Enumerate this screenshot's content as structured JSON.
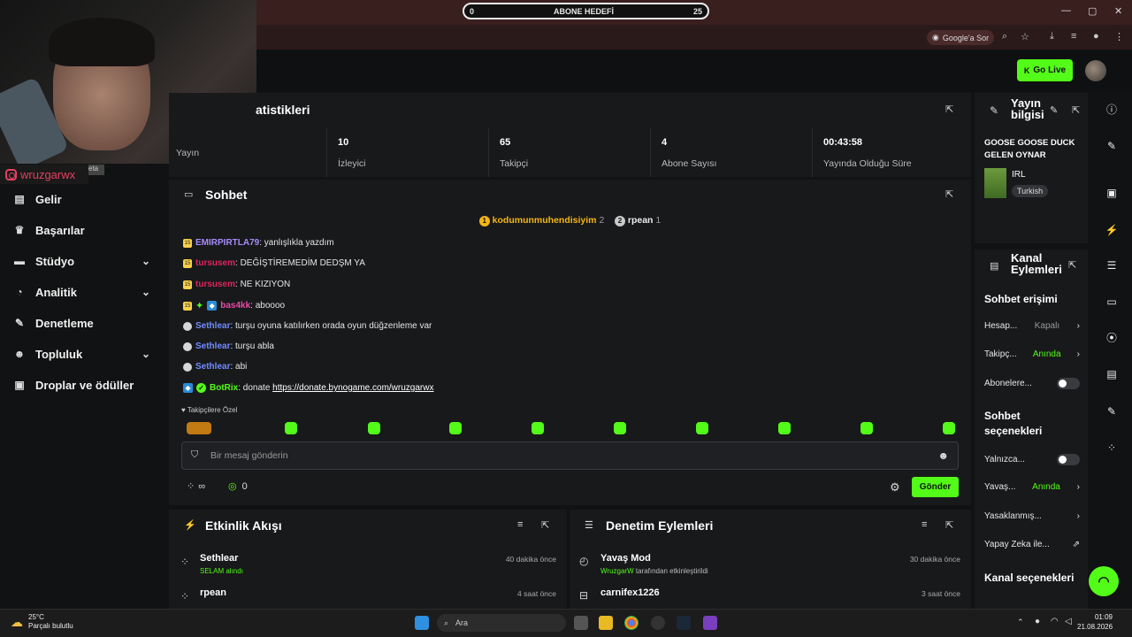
{
  "browser": {
    "goal_left": "0",
    "goal_label": "ABONE HEDEFİ",
    "goal_right": "25",
    "google_label": "Google'a Sor"
  },
  "header": {
    "go_live_label": "Go Live"
  },
  "overlay": {
    "instagram_handle": "wruzgarwx",
    "beta": "eta"
  },
  "sidebar": {
    "items": [
      {
        "label": "Gelir",
        "icon": "list-icon"
      },
      {
        "label": "Başarılar",
        "icon": "trophy-icon"
      },
      {
        "label": "Stüdyo",
        "icon": "studio-icon",
        "expandable": true
      },
      {
        "label": "Analitik",
        "icon": "chart-icon",
        "expandable": true
      },
      {
        "label": "Denetleme",
        "icon": "wrench-icon"
      },
      {
        "label": "Topluluk",
        "icon": "people-icon",
        "expandable": true
      },
      {
        "label": "Droplar ve ödüller",
        "icon": "gift-icon"
      }
    ]
  },
  "stats": {
    "title": "atistikleri",
    "cells": [
      {
        "value": "",
        "label": "Yayın"
      },
      {
        "value": "10",
        "label": "İzleyici"
      },
      {
        "value": "65",
        "label": "Takipçi"
      },
      {
        "value": "4",
        "label": "Abone Sayısı"
      },
      {
        "value": "00:43:58",
        "label": "Yayında Olduğu Süre"
      }
    ]
  },
  "chat": {
    "title": "Sohbet",
    "pinned": [
      {
        "name": "kodumunmuhendisiyim",
        "count": "2",
        "rank": "1"
      },
      {
        "name": "rpean",
        "count": "1",
        "rank": "2"
      }
    ],
    "messages": [
      {
        "user": "EMIRPIRTLA79",
        "text": ": yanlışlıkla yazdım",
        "color": "#a78bfa",
        "badges": "sub"
      },
      {
        "user": "tursusem",
        "text": ": DEĞİŞTİREMEDİM DEDŞM YA",
        "color": "#e0245e",
        "badges": "sub"
      },
      {
        "user": "tursusem",
        "text": ": NE KIZIYON",
        "color": "#e0245e",
        "badges": "sub"
      },
      {
        "user": "bas4kk",
        "text": ": aboooo",
        "color": "#e84ba6",
        "badges": "sub-star-bot"
      },
      {
        "user": "Sethlear",
        "text": ": turşu oyuna katılırken orada oyun düğzenleme var",
        "color": "#6f8cff",
        "badges": "dot"
      },
      {
        "user": "Sethlear",
        "text": ": turşu abla",
        "color": "#6f8cff",
        "badges": "dot"
      },
      {
        "user": "Sethlear",
        "text": ": abi",
        "color": "#6f8cff",
        "badges": "dot"
      },
      {
        "user": "BotRix",
        "text": ": donate ",
        "link": "https://donate.bynogame.com/wruzgarwx",
        "color": "#53fc18",
        "badges": "bot-check"
      }
    ],
    "emote_label": "Takipçilere Özel",
    "input_placeholder": "Bir mesaj gönderin",
    "count_left": "∞",
    "count_right": "0",
    "send_label": "Gönder"
  },
  "activity": {
    "title": "Etkinlik Akışı",
    "items": [
      {
        "name": "Sethlear",
        "sub": "SELAM alındı",
        "time": "40 dakika önce"
      },
      {
        "name": "rpean",
        "sub": "",
        "time": "4 saat önce"
      }
    ]
  },
  "moderation": {
    "title": "Denetim Eylemleri",
    "items": [
      {
        "name": "Yavaş Mod",
        "sub_user": "WruzgarW",
        "sub_text": " tarafından etkinleştirildi",
        "time": "30 dakika önce"
      },
      {
        "name": "carnifex1226",
        "sub_user": "",
        "sub_text": "",
        "time": "3 saat önce"
      }
    ]
  },
  "stream_info": {
    "title": "Yayın bilgisi",
    "stream_title": "GOOSE GOOSE DUCK GELEN OYNAR",
    "category": "IRL",
    "language": "Turkish"
  },
  "channel_actions": {
    "title": "Kanal Eylemleri",
    "chat_access_heading": "Sohbet erişimi",
    "rows1": [
      {
        "label": "Hesap...",
        "value": "Kapalı",
        "control": "chevron"
      },
      {
        "label": "Takipç...",
        "value": "Anında",
        "control": "chevron"
      },
      {
        "label": "Abonelere...",
        "value": "",
        "control": "toggle"
      }
    ],
    "chat_options_heading": "Sohbet seçenekleri",
    "rows2": [
      {
        "label": "Yalnızca...",
        "value": "",
        "control": "toggle"
      },
      {
        "label": "Yavaş...",
        "value": "Anında",
        "control": "chevron"
      },
      {
        "label": "Yasaklanmış...",
        "value": "",
        "control": "chevron"
      },
      {
        "label": "Yapay Zeka ile...",
        "value": "",
        "control": "external"
      }
    ],
    "channel_options_heading": "Kanal seçenekleri"
  },
  "taskbar": {
    "temperature": "25°C",
    "weather": "Parçalı bulutlu",
    "search_label": "Ara",
    "time": "01:09",
    "date": "21.08.2026"
  },
  "colors": {
    "accent": "#53fc18",
    "panel": "#18191b",
    "background": "#111213"
  }
}
